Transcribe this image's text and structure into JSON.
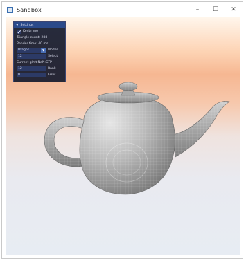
{
  "window": {
    "title": "Sandbox",
    "controls": {
      "minimize": "–",
      "maximize": "☐",
      "close": "✕"
    }
  },
  "panel": {
    "header": "Settings",
    "header_arrow": "▼",
    "checkbox_label": "Keybr mo",
    "triangle_count": "Triangle count: 288",
    "render_time": "Render time:    40 ms",
    "dropdown_value": "Utagos",
    "dropdown_arrow": "▼",
    "dropdown_label": "Model",
    "select_value": "12",
    "select_label": "Select",
    "error_text": "Current glmt:NaN:GTP",
    "rank_value": "12",
    "rank_label": "Rank",
    "error_value": "0",
    "error_label": "Error"
  }
}
